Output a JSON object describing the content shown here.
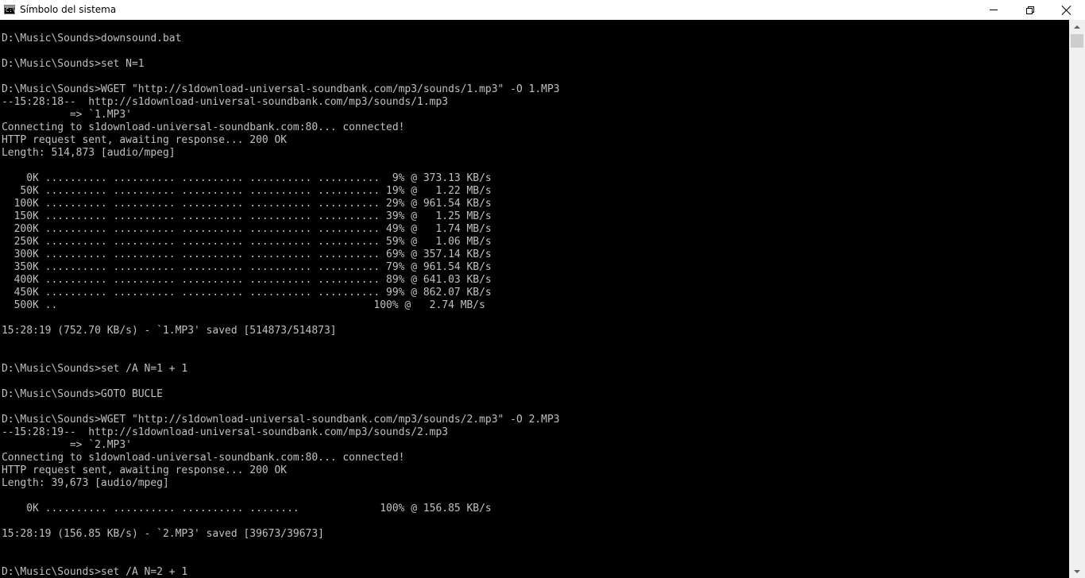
{
  "window": {
    "title": "Símbolo del sistema",
    "icon": "cmd-icon",
    "icon_text": "C:\\",
    "controls": {
      "minimize": "minimize-icon",
      "maximize": "restore-icon",
      "close": "close-icon"
    }
  },
  "console": {
    "background": "#000000",
    "foreground": "#c0c0c0",
    "lines": [
      "D:\\Music\\Sounds>downsound.bat",
      "",
      "D:\\Music\\Sounds>set N=1",
      "",
      "D:\\Music\\Sounds>WGET \"http://s1download-universal-soundbank.com/mp3/sounds/1.mp3\" -O 1.MP3",
      "--15:28:18--  http://s1download-universal-soundbank.com/mp3/sounds/1.mp3",
      "           => `1.MP3'",
      "Connecting to s1download-universal-soundbank.com:80... connected!",
      "HTTP request sent, awaiting response... 200 OK",
      "Length: 514,873 [audio/mpeg]",
      "",
      "    0K .......... .......... .......... .......... ..........  9% @ 373.13 KB/s",
      "   50K .......... .......... .......... .......... .......... 19% @   1.22 MB/s",
      "  100K .......... .......... .......... .......... .......... 29% @ 961.54 KB/s",
      "  150K .......... .......... .......... .......... .......... 39% @   1.25 MB/s",
      "  200K .......... .......... .......... .......... .......... 49% @   1.74 MB/s",
      "  250K .......... .......... .......... .......... .......... 59% @   1.06 MB/s",
      "  300K .......... .......... .......... .......... .......... 69% @ 357.14 KB/s",
      "  350K .......... .......... .......... .......... .......... 79% @ 961.54 KB/s",
      "  400K .......... .......... .......... .......... .......... 89% @ 641.03 KB/s",
      "  450K .......... .......... .......... .......... .......... 99% @ 862.07 KB/s",
      "  500K ..                                                   100% @   2.74 MB/s",
      "",
      "15:28:19 (752.70 KB/s) - `1.MP3' saved [514873/514873]",
      "",
      "",
      "D:\\Music\\Sounds>set /A N=1 + 1",
      "",
      "D:\\Music\\Sounds>GOTO BUCLE",
      "",
      "D:\\Music\\Sounds>WGET \"http://s1download-universal-soundbank.com/mp3/sounds/2.mp3\" -O 2.MP3",
      "--15:28:19--  http://s1download-universal-soundbank.com/mp3/sounds/2.mp3",
      "           => `2.MP3'",
      "Connecting to s1download-universal-soundbank.com:80... connected!",
      "HTTP request sent, awaiting response... 200 OK",
      "Length: 39,673 [audio/mpeg]",
      "",
      "    0K .......... .......... .......... ........             100% @ 156.85 KB/s",
      "",
      "15:28:19 (156.85 KB/s) - `2.MP3' saved [39673/39673]",
      "",
      "",
      "D:\\Music\\Sounds>set /A N=2 + 1"
    ]
  },
  "scrollbar": {
    "up_icon": "scroll-up-arrow-icon",
    "down_icon": "scroll-down-arrow-icon"
  }
}
